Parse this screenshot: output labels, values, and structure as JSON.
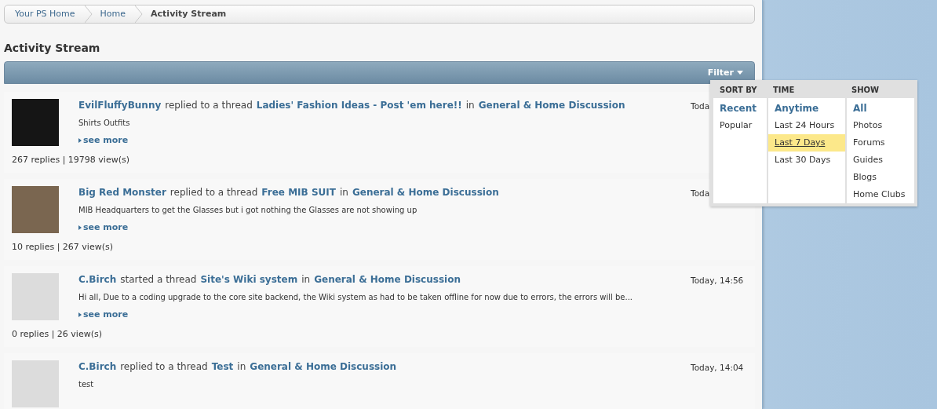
{
  "breadcrumb": [
    {
      "label": "Your PS Home",
      "current": false
    },
    {
      "label": "Home",
      "current": false
    },
    {
      "label": "Activity Stream",
      "current": true
    }
  ],
  "page_title": "Activity Stream",
  "filter": {
    "label": "Filter",
    "expanded": true,
    "columns": [
      {
        "heading": "SORT BY",
        "options": [
          {
            "label": "Recent",
            "selected": true,
            "highlighted": false
          },
          {
            "label": "Popular",
            "selected": false,
            "highlighted": false
          }
        ]
      },
      {
        "heading": "TIME",
        "options": [
          {
            "label": "Anytime",
            "selected": true,
            "highlighted": false
          },
          {
            "label": "Last 24 Hours",
            "selected": false,
            "highlighted": false
          },
          {
            "label": "Last 7 Days",
            "selected": false,
            "highlighted": true
          },
          {
            "label": "Last 30 Days",
            "selected": false,
            "highlighted": false
          }
        ]
      },
      {
        "heading": "SHOW",
        "options": [
          {
            "label": "All",
            "selected": true,
            "highlighted": false
          },
          {
            "label": "Photos",
            "selected": false,
            "highlighted": false
          },
          {
            "label": "Forums",
            "selected": false,
            "highlighted": false
          },
          {
            "label": "Guides",
            "selected": false,
            "highlighted": false
          },
          {
            "label": "Blogs",
            "selected": false,
            "highlighted": false
          },
          {
            "label": "Home Clubs",
            "selected": false,
            "highlighted": false
          }
        ]
      }
    ]
  },
  "activities": [
    {
      "headline": [
        {
          "kind": "link",
          "text": "EvilFluffyBunny"
        },
        {
          "kind": "plain",
          "text": "replied to a thread"
        },
        {
          "kind": "link",
          "text": "Ladies' Fashion Ideas - Post 'em here!!"
        },
        {
          "kind": "plain",
          "text": "in"
        },
        {
          "kind": "link",
          "text": "General & Home Discussion"
        }
      ],
      "excerpt": "Shirts Outfits",
      "see_more": "see more",
      "stats": "267 replies | 19798 view(s)",
      "time": "Toda"
    },
    {
      "headline": [
        {
          "kind": "link",
          "text": "Big Red Monster"
        },
        {
          "kind": "plain",
          "text": "replied to a thread"
        },
        {
          "kind": "link",
          "text": "Free MIB SUIT"
        },
        {
          "kind": "plain",
          "text": "in"
        },
        {
          "kind": "link",
          "text": "General & Home Discussion"
        }
      ],
      "excerpt": "MIB Headquarters to get the Glasses but i got nothing the Glasses are not showing up",
      "see_more": "see more",
      "stats": "10 replies | 267 view(s)",
      "time": "Toda"
    },
    {
      "headline": [
        {
          "kind": "link",
          "text": "C.Birch"
        },
        {
          "kind": "plain",
          "text": "started a thread"
        },
        {
          "kind": "link",
          "text": "Site's Wiki system"
        },
        {
          "kind": "plain",
          "text": "in"
        },
        {
          "kind": "link",
          "text": "General & Home Discussion"
        }
      ],
      "excerpt": "Hi all, Due to a coding upgrade to the core site backend, the Wiki system as had to be taken offline for now due to errors, the errors will be...",
      "see_more": "see more",
      "stats": "0 replies | 26 view(s)",
      "time": "Today, 14:56"
    },
    {
      "headline": [
        {
          "kind": "link",
          "text": "C.Birch"
        },
        {
          "kind": "plain",
          "text": "replied to a thread"
        },
        {
          "kind": "link",
          "text": "Test"
        },
        {
          "kind": "plain",
          "text": "in"
        },
        {
          "kind": "link",
          "text": "General & Home Discussion"
        }
      ],
      "excerpt": "test",
      "time": "Today, 14:04"
    }
  ]
}
